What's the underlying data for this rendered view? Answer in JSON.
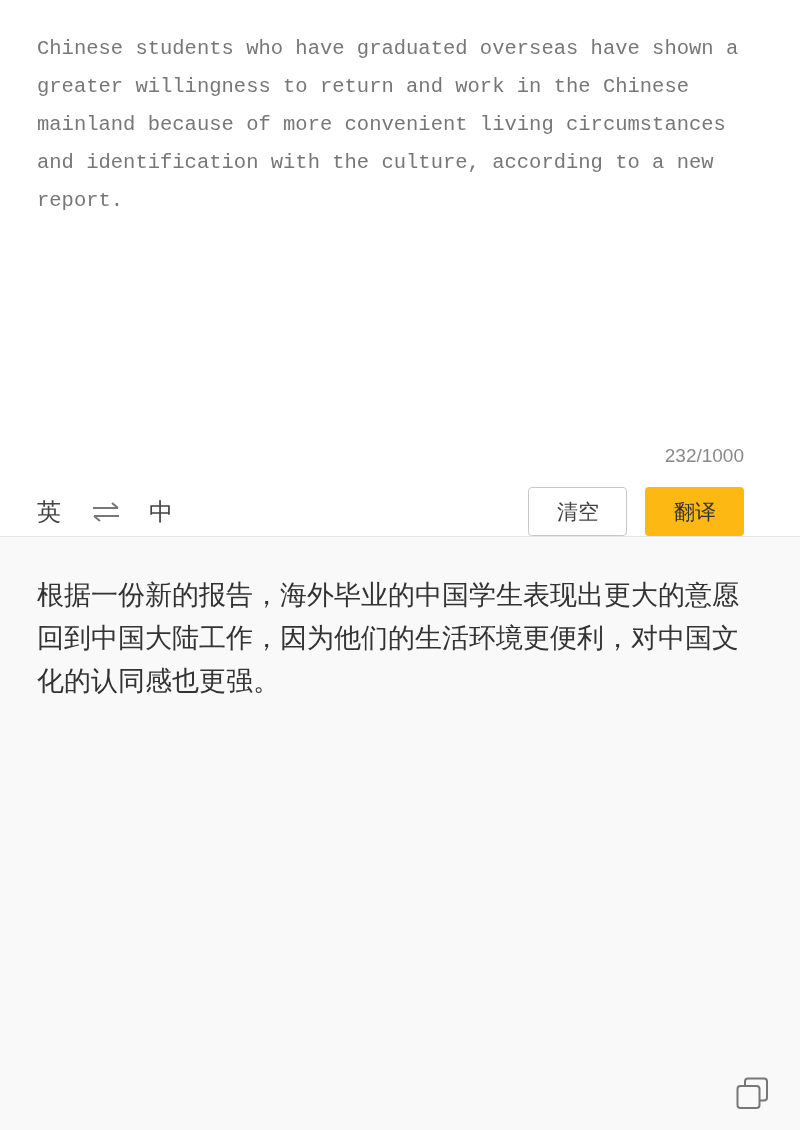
{
  "source": {
    "value": "Chinese students who have graduated overseas have shown a greater willingness to return and work in the Chinese mainland because of more convenient living circumstances and identification with the culture, according to a new report.",
    "counter": "232/1000"
  },
  "languages": {
    "from": "英",
    "to": "中"
  },
  "buttons": {
    "clear": "清空",
    "translate": "翻译"
  },
  "result": {
    "text": "根据一份新的报告，海外毕业的中国学生表现出更大的意愿回到中国大陆工作，因为他们的生活环境更便利，对中国文化的认同感也更强。"
  }
}
